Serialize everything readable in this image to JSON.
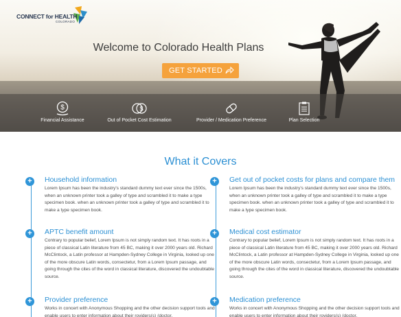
{
  "brand": {
    "logo_main": "CONNECT for HEALTH",
    "logo_sub": "COLORADO"
  },
  "hero": {
    "title": "Welcome to Colorado Health Plans",
    "cta_label": "GET STARTED"
  },
  "features": [
    {
      "label": "Financial Assistance",
      "icon": "dollar-hand-icon"
    },
    {
      "label": "Out of Pocket Cost Estimation",
      "icon": "coins-icon"
    },
    {
      "label": "Provider / Medication Preference",
      "icon": "pill-icon"
    },
    {
      "label": "Plan Selection",
      "icon": "clipboard-icon"
    }
  ],
  "main": {
    "title": "What it Covers",
    "items": [
      {
        "title": "Household information",
        "text": "Lorem Ipsum has been the industry's standard dummy text ever since the 1500s, when an unknown printer took a galley of type and scrambled it to make a type specimen book. when an unknown printer took a galley of type and scrambled it to make a type specimen book."
      },
      {
        "title": "Get out of pocket costs for plans and compare them",
        "text": "Lorem Ipsum has been the industry's standard dummy text ever since the 1500s, when an unknown printer took a galley of type and scrambled it to make a type specimen book. when an unknown printer took a galley of type and scrambled it to make a type specimen book."
      },
      {
        "title": "APTC benefit amount",
        "text": "Contrary to popular belief, Lorem Ipsum is not simply random text. It has roots in a piece of classical Latin literature from 45 BC, making it over 2000 years old. Richard McClintock, a Latin professor at Hampden-Sydney College in Virginia, looked up one of the more obscure Latin words, consectetur, from a Lorem Ipsum passage, and going through the cites of the word in classical literature, discovered the undoubtable source."
      },
      {
        "title": "Medical cost estimator",
        "text": "Contrary to popular belief, Lorem Ipsum is not simply random text. It has roots in a piece of classical Latin literature from 45 BC, making it over 2000 years old. Richard McClintock, a Latin professor at Hampden-Sydney College in Virginia, looked up one of the more obscure Latin words, consectetur, from a Lorem Ipsum passage, and going through the cites of the word in classical literature, discovered the undoubtable source."
      },
      {
        "title": "Provider preference",
        "text": "Works in concert with Anonymous Shopping and the other decision support tools and enable users to enter information about their roviders(s) (doctor,"
      },
      {
        "title": "Medication preference",
        "text": "Works in concert with Anonymous Shopping and the other decision support tools and enable users to enter information about their roviders(s) (doctor,"
      }
    ]
  },
  "colors": {
    "accent_blue": "#2b8fd3",
    "cta_orange": "#f5a23c"
  }
}
